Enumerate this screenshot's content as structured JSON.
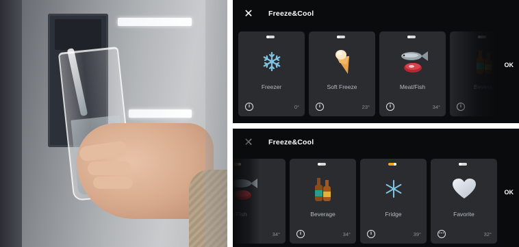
{
  "panel_top": {
    "title": "Freeze&Cool",
    "close_icon": "close-icon",
    "ok_label": "OK",
    "cards": [
      {
        "label": "Freezer",
        "temp": "0°",
        "icon": "snowflake-icon",
        "toggle_on": false
      },
      {
        "label": "Soft Freeze",
        "temp": "23°",
        "icon": "ice-cream-icon",
        "toggle_on": false
      },
      {
        "label": "Meat/Fish",
        "temp": "34°",
        "icon": "meat-fish-icon",
        "toggle_on": false
      },
      {
        "label": "Bevera",
        "temp": "",
        "icon": "bottles-icon",
        "toggle_on": false
      }
    ]
  },
  "panel_bottom": {
    "title": "Freeze&Cool",
    "close_icon": "close-icon",
    "ok_label": "OK",
    "cards": [
      {
        "label": "t/Fish",
        "temp": "34°",
        "icon": "meat-fish-icon",
        "toggle_on": true
      },
      {
        "label": "Beverage",
        "temp": "34°",
        "icon": "bottles-icon",
        "toggle_on": false
      },
      {
        "label": "Fridge",
        "temp": "39°",
        "icon": "asterisk-icon",
        "toggle_on": true
      },
      {
        "label": "Favorite",
        "temp": "32°",
        "icon": "heart-icon",
        "toggle_on": false,
        "info_icon": "more-icon"
      }
    ]
  },
  "colors": {
    "panel_bg": "#0a0b0d",
    "card_bg": "#2a2c30",
    "toggle_on": "#f0a321",
    "toggle_off": "#d9d9d9",
    "snowflake": "#7fc4e3"
  }
}
